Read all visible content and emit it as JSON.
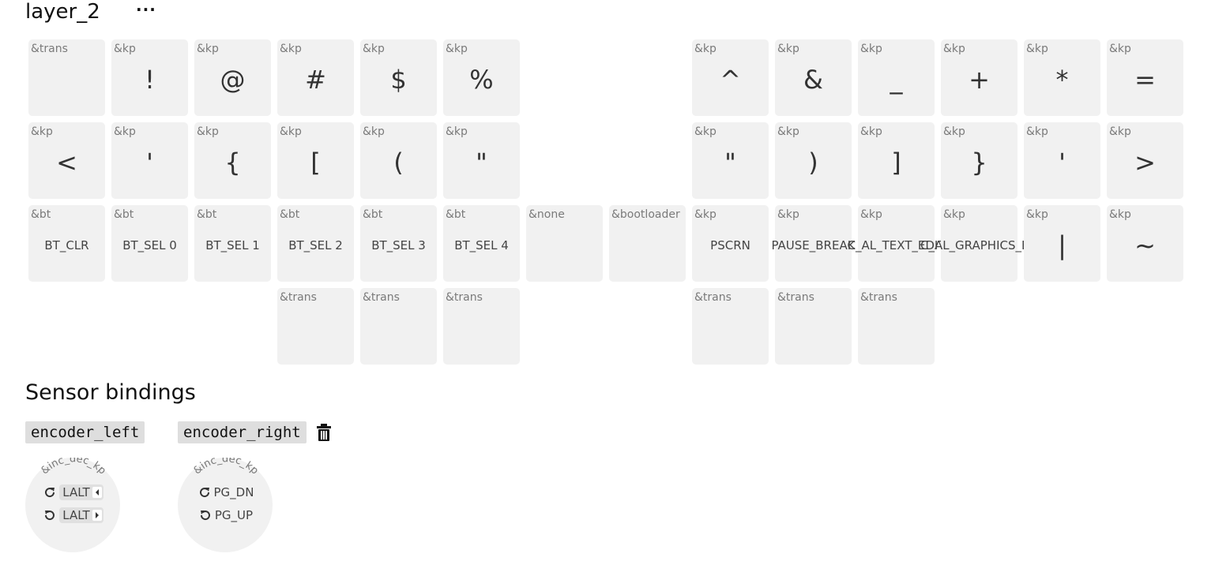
{
  "layer": {
    "name": "layer_2",
    "more_label": "···"
  },
  "keys": [
    {
      "behavior": "&trans",
      "param": ""
    },
    {
      "behavior": "&kp",
      "param": "!"
    },
    {
      "behavior": "&kp",
      "param": "@"
    },
    {
      "behavior": "&kp",
      "param": "#"
    },
    {
      "behavior": "&kp",
      "param": "$"
    },
    {
      "behavior": "&kp",
      "param": "%"
    },
    {
      "behavior": "&kp",
      "param": "^"
    },
    {
      "behavior": "&kp",
      "param": "&"
    },
    {
      "behavior": "&kp",
      "param": "_"
    },
    {
      "behavior": "&kp",
      "param": "+"
    },
    {
      "behavior": "&kp",
      "param": "*"
    },
    {
      "behavior": "&kp",
      "param": "="
    },
    {
      "behavior": "&kp",
      "param": "<"
    },
    {
      "behavior": "&kp",
      "param": "'"
    },
    {
      "behavior": "&kp",
      "param": "{"
    },
    {
      "behavior": "&kp",
      "param": "["
    },
    {
      "behavior": "&kp",
      "param": "("
    },
    {
      "behavior": "&kp",
      "param": "\""
    },
    {
      "behavior": "&kp",
      "param": "\""
    },
    {
      "behavior": "&kp",
      "param": ")"
    },
    {
      "behavior": "&kp",
      "param": "]"
    },
    {
      "behavior": "&kp",
      "param": "}"
    },
    {
      "behavior": "&kp",
      "param": "'"
    },
    {
      "behavior": "&kp",
      "param": ">"
    },
    {
      "behavior": "&bt",
      "param": "BT_CLR"
    },
    {
      "behavior": "&bt",
      "param": "BT_SEL 0"
    },
    {
      "behavior": "&bt",
      "param": "BT_SEL 1"
    },
    {
      "behavior": "&bt",
      "param": "BT_SEL 2"
    },
    {
      "behavior": "&bt",
      "param": "BT_SEL 3"
    },
    {
      "behavior": "&bt",
      "param": "BT_SEL 4"
    },
    {
      "behavior": "&none",
      "param": ""
    },
    {
      "behavior": "&bootloader",
      "param": ""
    },
    {
      "behavior": "&kp",
      "param": "PSCRN"
    },
    {
      "behavior": "&kp",
      "param": "PAUSE_BREAK"
    },
    {
      "behavior": "&kp",
      "param": "C_AL_TEXT_EDIT"
    },
    {
      "behavior": "&kp",
      "param": "C_AL_GRAPHICS_ED"
    },
    {
      "behavior": "&kp",
      "param": "|"
    },
    {
      "behavior": "&kp",
      "param": "~"
    },
    {
      "behavior": "&trans",
      "param": ""
    },
    {
      "behavior": "&trans",
      "param": ""
    },
    {
      "behavior": "&trans",
      "param": ""
    },
    {
      "behavior": "&trans",
      "param": ""
    },
    {
      "behavior": "&trans",
      "param": ""
    },
    {
      "behavior": "&trans",
      "param": ""
    }
  ],
  "sensors": {
    "title": "Sensor bindings",
    "encoders": [
      {
        "name": "encoder_left",
        "behavior": "&inc_dec_kp",
        "cw": "LALT",
        "ccw": "LALT",
        "cw_arrow": "left",
        "ccw_arrow": "right"
      },
      {
        "name": "encoder_right",
        "behavior": "&inc_dec_kp",
        "cw": "PG_DN",
        "ccw": "PG_UP"
      }
    ]
  },
  "icons": {
    "more": "more-icon",
    "trash": "trash-icon",
    "cw": "rotate-cw-icon",
    "ccw": "rotate-ccw-icon"
  }
}
